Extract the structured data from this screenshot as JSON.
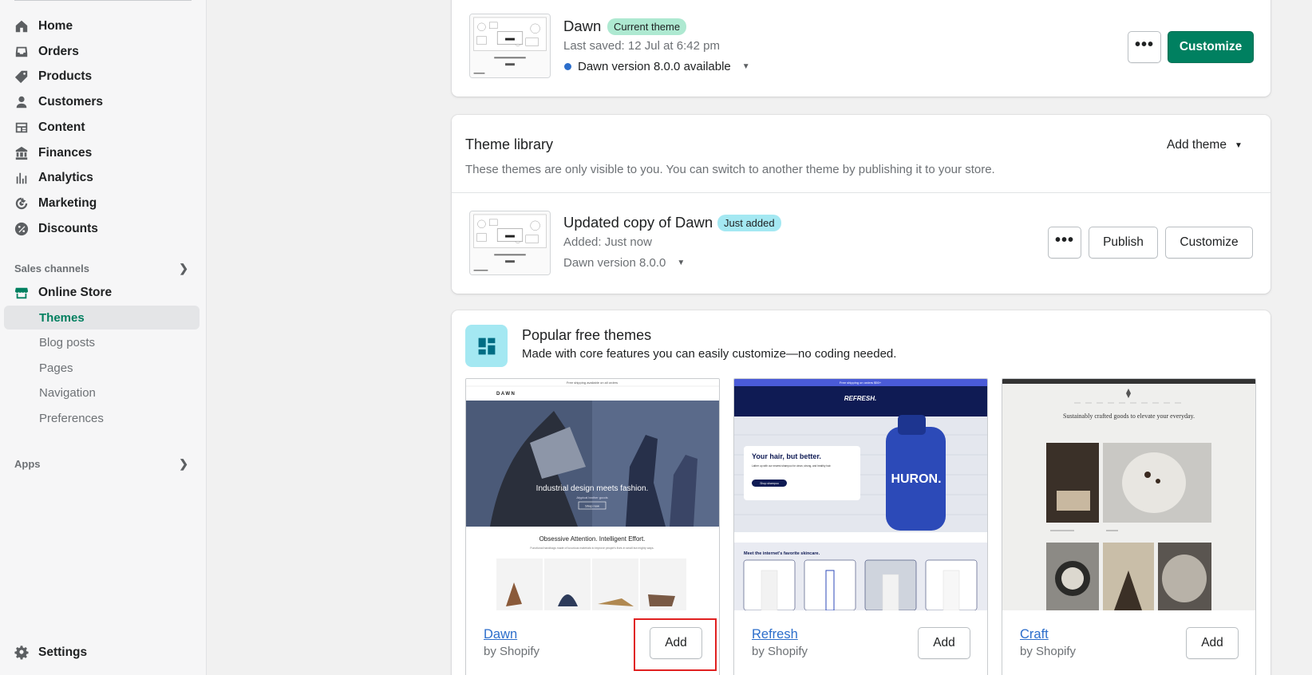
{
  "sidebar": {
    "nav": [
      {
        "label": "Home",
        "icon": "home-icon"
      },
      {
        "label": "Orders",
        "icon": "orders-icon"
      },
      {
        "label": "Products",
        "icon": "tag-icon"
      },
      {
        "label": "Customers",
        "icon": "person-icon"
      },
      {
        "label": "Content",
        "icon": "content-icon"
      },
      {
        "label": "Finances",
        "icon": "bank-icon"
      },
      {
        "label": "Analytics",
        "icon": "bar-chart-icon"
      },
      {
        "label": "Marketing",
        "icon": "target-icon"
      },
      {
        "label": "Discounts",
        "icon": "discount-icon"
      }
    ],
    "sales_channels_label": "Sales channels",
    "online_store_label": "Online Store",
    "sub_items": [
      "Themes",
      "Blog posts",
      "Pages",
      "Navigation",
      "Preferences"
    ],
    "apps_label": "Apps",
    "settings_label": "Settings"
  },
  "current_theme": {
    "name": "Dawn",
    "badge": "Current theme",
    "last_saved": "Last saved: 12 Jul at 6:42 pm",
    "version": "Dawn version 8.0.0 available",
    "more_label": "•••",
    "customize_label": "Customize"
  },
  "library": {
    "title": "Theme library",
    "subtitle": "These themes are only visible to you. You can switch to another theme by publishing it to your store.",
    "add_theme_label": "Add theme",
    "item": {
      "name": "Updated copy of Dawn",
      "badge": "Just added",
      "added": "Added: Just now",
      "version": "Dawn version 8.0.0",
      "more_label": "•••",
      "publish_label": "Publish",
      "customize_label": "Customize"
    }
  },
  "popular": {
    "title": "Popular free themes",
    "subtitle": "Made with core features you can easily customize—no coding needed.",
    "themes": [
      {
        "name": "Dawn",
        "by": "by Shopify",
        "add_label": "Add",
        "preview": {
          "announcement": "Free shipping available on all orders",
          "logo": "DAWN",
          "hero": "Industrial design meets fashion.",
          "hero_sub": "Atypical leather goods",
          "hero_btn": "Shop now",
          "heading": "Obsessive Attention. Intelligent Effort.",
          "subtext": "Functional handbags made of luxurious materials to improve people's lives in small but mighty ways."
        }
      },
      {
        "name": "Refresh",
        "by": "by Shopify",
        "add_label": "Add",
        "preview": {
          "announcement": "Free shipping on orders $50+",
          "logo": "REFRESH.",
          "hero": "Your hair, but better.",
          "hero_sub": "Lather up with our newest shampoo for clean, strong, and healthy hair.",
          "hero_btn": "Shop shampoo",
          "bottle": "HURON.",
          "heading": "Meet the internet's favorite skincare."
        }
      },
      {
        "name": "Craft",
        "by": "by Shopify",
        "add_label": "Add",
        "preview": {
          "heading": "Sustainably crafted goods to elevate your everyday."
        }
      }
    ]
  },
  "colors": {
    "primary": "#008060",
    "link": "#2c6ecb",
    "highlight": "#e02020"
  }
}
